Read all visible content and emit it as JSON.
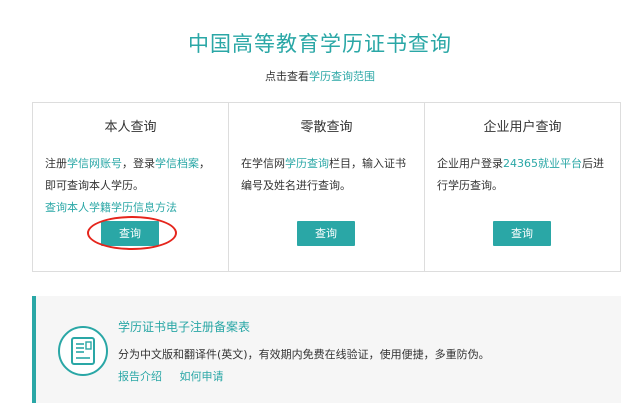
{
  "header": {
    "title": "中国高等教育学历证书查询",
    "subtitle_prefix": "点击查看",
    "subtitle_link": "学历查询范围"
  },
  "cards": [
    {
      "title": "本人查询",
      "text_1": "注册",
      "link_1": "学信网账号",
      "text_2": "，登录",
      "link_2": "学信档案",
      "text_3": "，即可查询本人学历。",
      "link_3": "查询本人学籍学历信息方法",
      "button": "查询"
    },
    {
      "title": "零散查询",
      "text_1": "在学信网",
      "link_1": "学历查询",
      "text_2": "栏目，输入证书编号及姓名进行查询。",
      "button": "查询"
    },
    {
      "title": "企业用户查询",
      "text_1": "企业用户登录",
      "link_1": "24365就业平台",
      "text_2": "后进行学历查询。",
      "button": "查询"
    }
  ],
  "info": {
    "title": "学历证书电子注册备案表",
    "desc": "分为中文版和翻译件(英文)，有效期内免费在线验证，使用便捷，多重防伪。",
    "link_1": "报告介绍",
    "link_2": "如何申请",
    "icon": "certificate-icon"
  },
  "colors": {
    "accent": "#2aa7a6",
    "highlight": "#e5251c"
  }
}
